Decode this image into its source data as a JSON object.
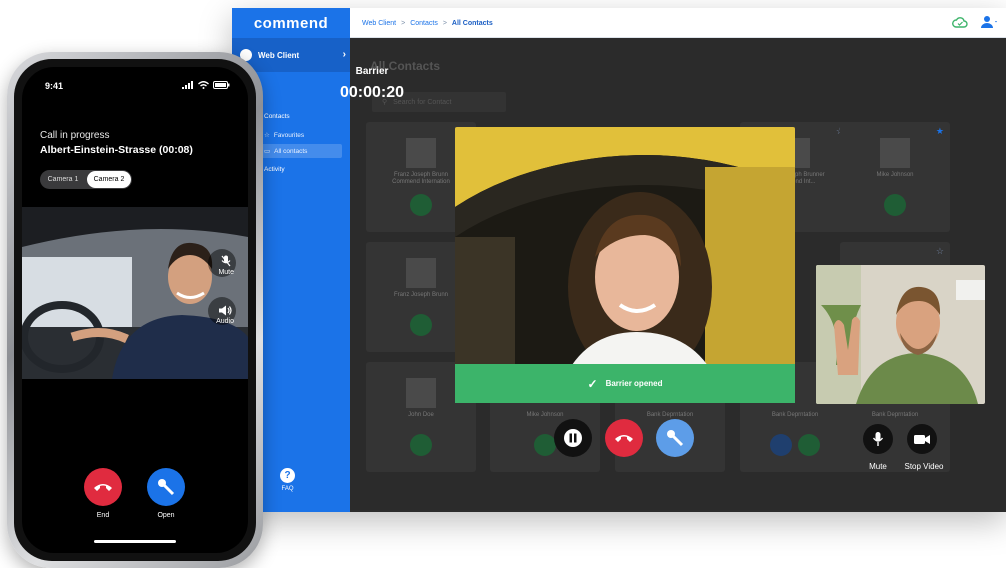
{
  "colors": {
    "brand_blue": "#1b73e8",
    "end_red": "#e02b3f",
    "open_blue": "#1b73e8",
    "success_green": "#3cb46a",
    "dark_bg": "#2b2b2b"
  },
  "web": {
    "brand": "commend",
    "breadcrumb": [
      "Web Client",
      "Contacts",
      "All Contacts"
    ],
    "sidebar": {
      "title": "Web Client",
      "section": "Contacts",
      "items": [
        "Favourites",
        "All contacts",
        "Activity"
      ],
      "faq": "FAQ"
    },
    "content_title": "All Contacts",
    "search_placeholder": "Search for Contact",
    "cards": [
      {
        "name": "Franz Joseph Brunn\nCommend Internation"
      },
      {
        "name": "Franz Joseph Brunner\nCommend Int..."
      },
      {
        "name": "Mike Johnson"
      },
      {
        "name": "Franz Joseph Brunn"
      },
      {
        "name": "John Doe"
      },
      {
        "name": "Mike Johnson"
      },
      {
        "name": "Bank Deprntation"
      },
      {
        "name": "Bank Deprntation"
      },
      {
        "name": "Bank Deprntation"
      }
    ],
    "call": {
      "title": "Barrier",
      "timer": "00:00:20",
      "banner": "Barrier opened",
      "mute_label": "Mute",
      "stop_video_label": "Stop Video"
    }
  },
  "phone": {
    "time": "9:41",
    "status": "Call in progress",
    "caller": "Albert-Einstein-Strasse (00:08)",
    "cameras": [
      "Camera 1",
      "Camera 2"
    ],
    "selected_camera": "Camera 2",
    "mute_label": "Mute",
    "audio_label": "Audio",
    "end_label": "End",
    "open_label": "Open"
  }
}
